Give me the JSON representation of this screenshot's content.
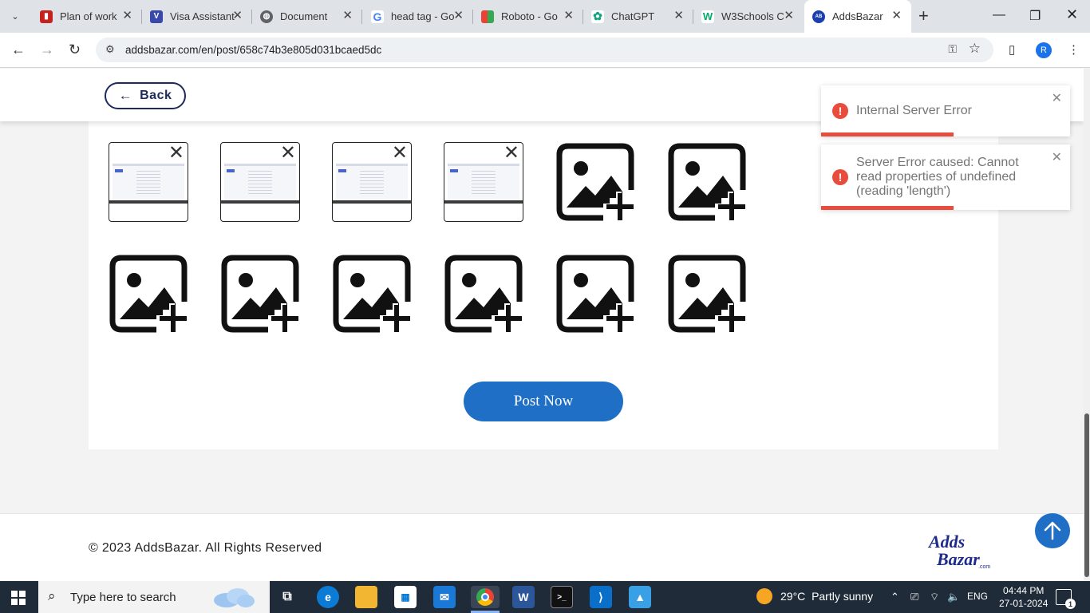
{
  "browser": {
    "tabs": [
      {
        "title": "Plan of work",
        "icon": "doc-red-icon",
        "color": "#c5221f"
      },
      {
        "title": "Visa Assistant",
        "icon": "visa-icon",
        "color": "#3949ab"
      },
      {
        "title": "Document",
        "icon": "globe-icon",
        "color": "#5f6368"
      },
      {
        "title": "head tag - Go",
        "icon": "google-icon",
        "color": "#4285f4"
      },
      {
        "title": "Roboto - Go",
        "icon": "fonts-icon",
        "color": "#34a853"
      },
      {
        "title": "ChatGPT",
        "icon": "chatgpt-icon",
        "color": "#10a37f"
      },
      {
        "title": "W3Schools C",
        "icon": "w3schools-icon",
        "color": "#04aa6d"
      },
      {
        "title": "AddsBazar",
        "icon": "addsbazar-icon",
        "color": "#1a3fae",
        "active": true
      }
    ],
    "url": "addsbazar.com/en/post/658c74b3e805d031bcaed5dc",
    "profile_initial": "R"
  },
  "page": {
    "back_label": "Back",
    "post_label": "Post Now",
    "uploaded_count": 4,
    "placeholder_count": 8,
    "footer_text": "© 2023 AddsBazar. All Rights Reserved",
    "logo_text_top": "Adds",
    "logo_text_bottom": "Bazar",
    "logo_suffix": ".com"
  },
  "toasts": [
    {
      "message": "Internal Server Error"
    },
    {
      "message": "Server Error caused: Cannot read properties of undefined (reading 'length')"
    }
  ],
  "colors": {
    "accent": "#1e6fc5",
    "error": "#e74c3c",
    "navy": "#1d2a5b"
  },
  "taskbar": {
    "search_placeholder": "Type here to search",
    "weather_temp": "29°C",
    "weather_text": "Partly sunny",
    "language": "ENG",
    "time": "04:44 PM",
    "date": "27-01-2024",
    "notification_count": "1"
  }
}
